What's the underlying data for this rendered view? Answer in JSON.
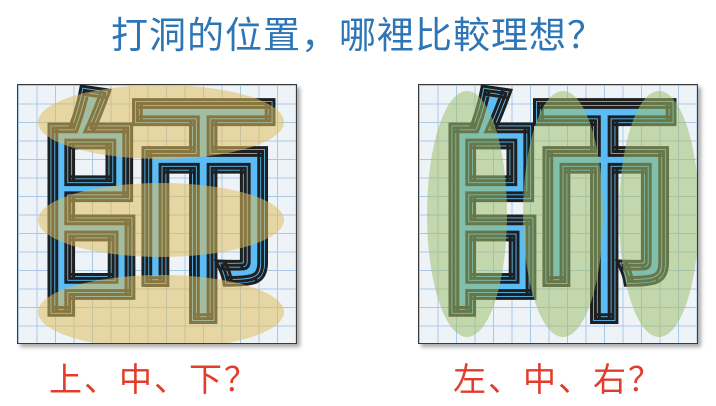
{
  "title": "打洞的位置，哪裡比較理想？",
  "left_panel": {
    "glyph": "師",
    "caption": "上、中、下？"
  },
  "right_panel": {
    "glyph": "師",
    "caption": "左、中、右？"
  },
  "colors": {
    "title": "#2e75b6",
    "caption": "#e23c2c",
    "glyph_fill": "#5bbcf6",
    "grid_line": "#a9c8e6",
    "horizontal_bands": "#debe5c",
    "vertical_bands": "#a0c06e"
  }
}
